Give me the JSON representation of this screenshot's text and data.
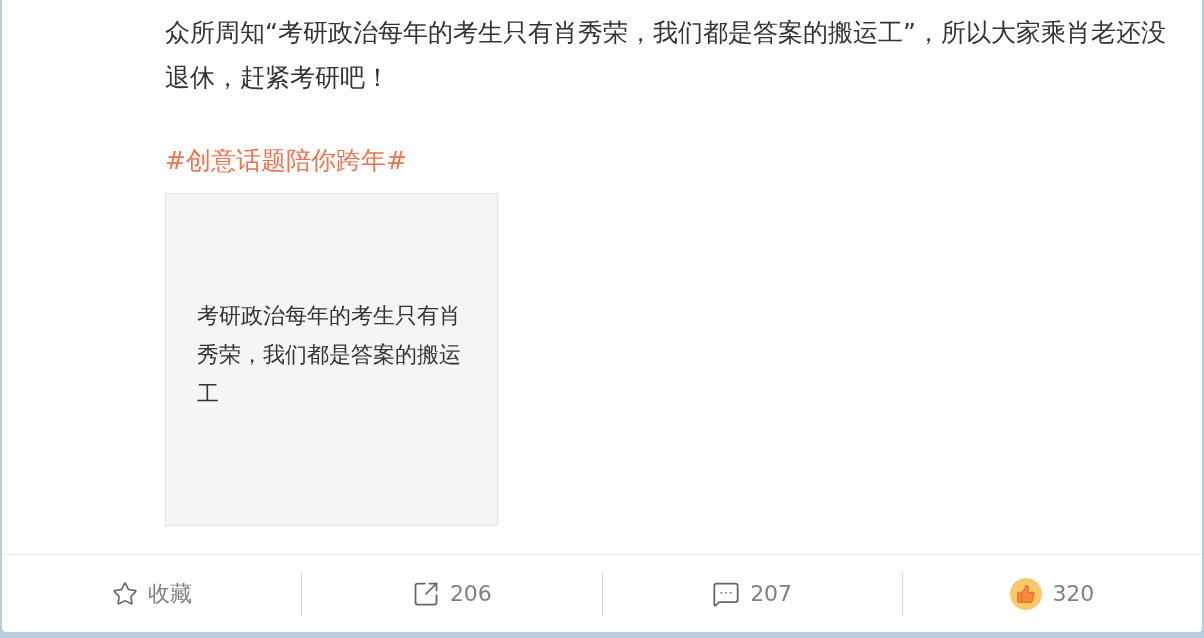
{
  "post": {
    "text": "众所周知“考研政治每年的考生只有肖秀荣，我们都是答案的搬运工”，所以大家乘肖老还没退休，赶紧考研吧！",
    "hashtag": "#创意话题陪你跨年#",
    "image_card": {
      "text": "考研政治每年的考生只有肖秀荣，我们都是答案的搬运工"
    }
  },
  "actions": [
    {
      "kind": "favorite",
      "label": "收藏"
    },
    {
      "kind": "repost",
      "label": "206"
    },
    {
      "kind": "comment",
      "label": "207"
    },
    {
      "kind": "like",
      "label": "320"
    }
  ]
}
